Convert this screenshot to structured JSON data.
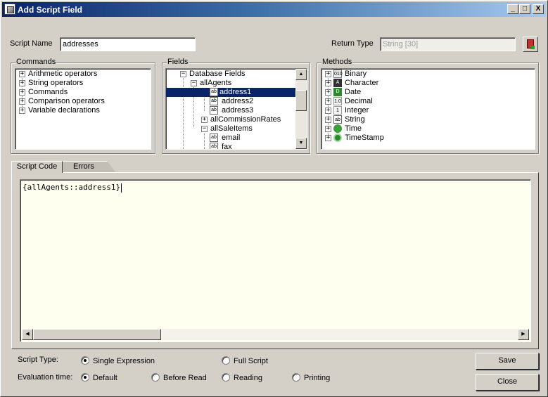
{
  "window": {
    "title": "Add Script Field",
    "minimize_glyph": "_",
    "maximize_glyph": "□",
    "close_glyph": "X"
  },
  "script_name": {
    "label": "Script Name",
    "value": "addresses"
  },
  "return_type": {
    "label": "Return Type",
    "value": "String [30]"
  },
  "commands": {
    "label": "Commands",
    "items": [
      "Arithmetic operators",
      "String operators",
      "Commands",
      "Comparison operators",
      "Variable declarations"
    ]
  },
  "fields": {
    "label": "Fields",
    "root": "Database Fields",
    "table": "allAgents",
    "columns": [
      "address1",
      "address2",
      "address3"
    ],
    "selected": "address1",
    "other_tables": [
      "allCommissionRates",
      "allSaleItems"
    ],
    "more_columns": [
      "email",
      "fax"
    ]
  },
  "methods": {
    "label": "Methods",
    "items": [
      {
        "label": "Binary",
        "icon": "010"
      },
      {
        "label": "Character",
        "icon": "A"
      },
      {
        "label": "Date",
        "icon": "D"
      },
      {
        "label": "Decimal",
        "icon": "1.0"
      },
      {
        "label": "Integer",
        "icon": "1"
      },
      {
        "label": "String",
        "icon": "ab"
      },
      {
        "label": "Time",
        "icon": "clock"
      },
      {
        "label": "TimeStamp",
        "icon": "stamp"
      }
    ]
  },
  "tabs": {
    "script_code": "Script Code",
    "errors": "Errors"
  },
  "editor": {
    "code": "{allAgents::address1}"
  },
  "script_type": {
    "label": "Script Type:",
    "single": "Single Expression",
    "full": "Full Script",
    "selected": "Single Expression"
  },
  "evaluation_time": {
    "label": "Evaluation time:",
    "default": "Default",
    "before_read": "Before Read",
    "reading": "Reading",
    "printing": "Printing",
    "selected": "Default"
  },
  "buttons": {
    "save": "Save",
    "close": "Close"
  },
  "icons": {
    "field_icon": "ab"
  },
  "colors": {
    "title_start": "#0a246a",
    "title_end": "#a6caf0",
    "selection": "#0a246a",
    "editor_bg": "#fffff0",
    "dialog_bg": "#d4d0c8"
  }
}
